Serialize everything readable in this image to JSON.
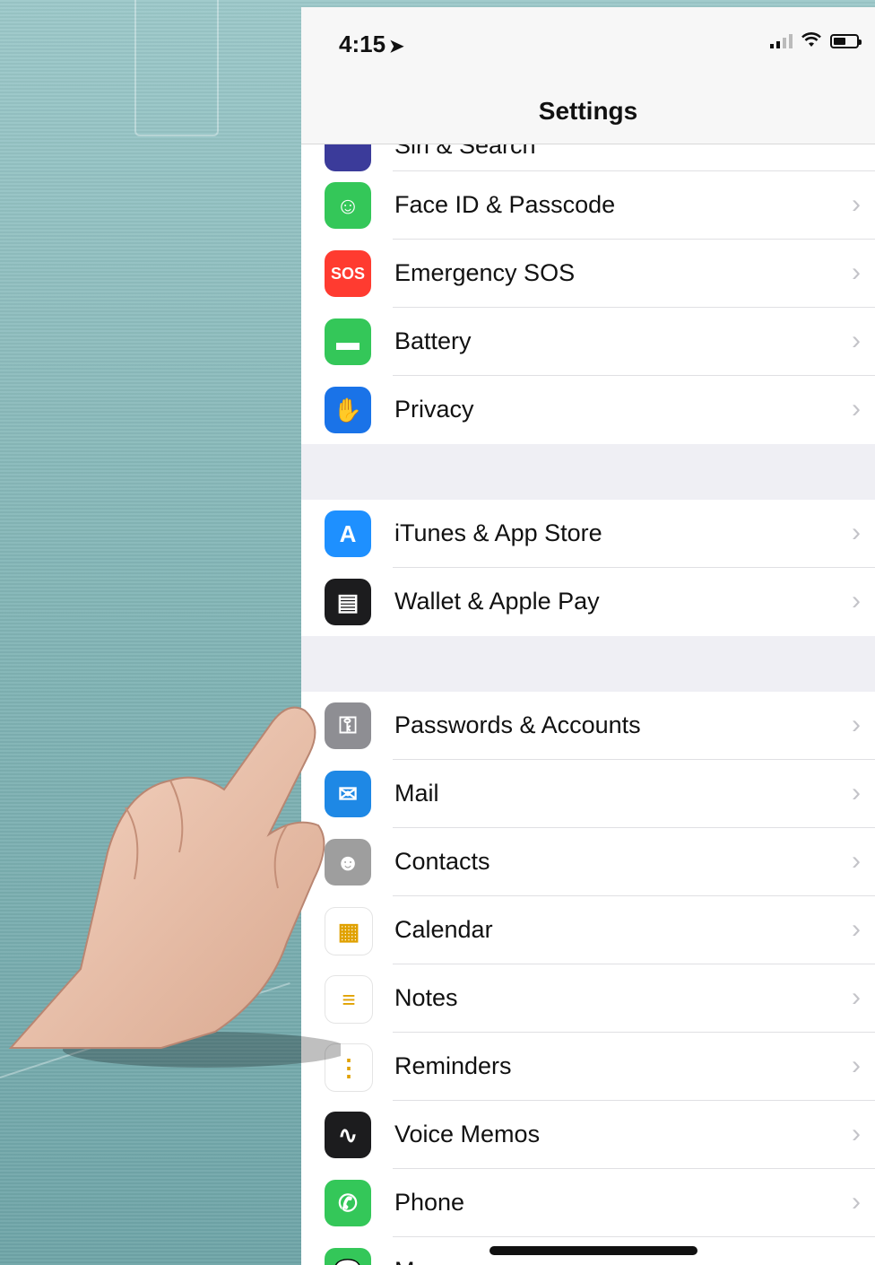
{
  "status_bar": {
    "time": "4:15",
    "location_arrow": "location-arrow-icon"
  },
  "nav": {
    "title": "Settings"
  },
  "partial_row": {
    "label": "Siri & Search",
    "icon": "siri-icon",
    "color": "#3b3b9a"
  },
  "group1": [
    {
      "label": "Face ID & Passcode",
      "icon": "face-id-icon",
      "color": "#34c759",
      "glyph": "☺"
    },
    {
      "label": "Emergency SOS",
      "icon": "sos-icon",
      "color": "#ff3b30",
      "glyph": "SOS"
    },
    {
      "label": "Battery",
      "icon": "battery-icon",
      "color": "#34c759",
      "glyph": "▬"
    },
    {
      "label": "Privacy",
      "icon": "hand-icon",
      "color": "#1a73e8",
      "glyph": "✋"
    }
  ],
  "group2": [
    {
      "label": "iTunes & App Store",
      "icon": "app-store-icon",
      "color": "#1e90ff",
      "glyph": "A"
    },
    {
      "label": "Wallet & Apple Pay",
      "icon": "wallet-icon",
      "color": "#1c1c1e",
      "glyph": "▤"
    }
  ],
  "group3": [
    {
      "label": "Passwords & Accounts",
      "icon": "key-icon",
      "color": "#8e8e93",
      "glyph": "⚿"
    },
    {
      "label": "Mail",
      "icon": "mail-icon",
      "color": "#1e88e5",
      "glyph": "✉"
    },
    {
      "label": "Contacts",
      "icon": "contacts-icon",
      "color": "#9e9e9e",
      "glyph": "☻"
    },
    {
      "label": "Calendar",
      "icon": "calendar-icon",
      "color": "#ffffff",
      "glyph": "▦"
    },
    {
      "label": "Notes",
      "icon": "notes-icon",
      "color": "#ffffff",
      "glyph": "≡"
    },
    {
      "label": "Reminders",
      "icon": "reminders-icon",
      "color": "#ffffff",
      "glyph": "⋮"
    },
    {
      "label": "Voice Memos",
      "icon": "voice-memos-icon",
      "color": "#1c1c1e",
      "glyph": "∿"
    },
    {
      "label": "Phone",
      "icon": "phone-icon",
      "color": "#34c759",
      "glyph": "✆"
    },
    {
      "label": "Messages",
      "icon": "messages-icon",
      "color": "#34c759",
      "glyph": "💬"
    }
  ]
}
